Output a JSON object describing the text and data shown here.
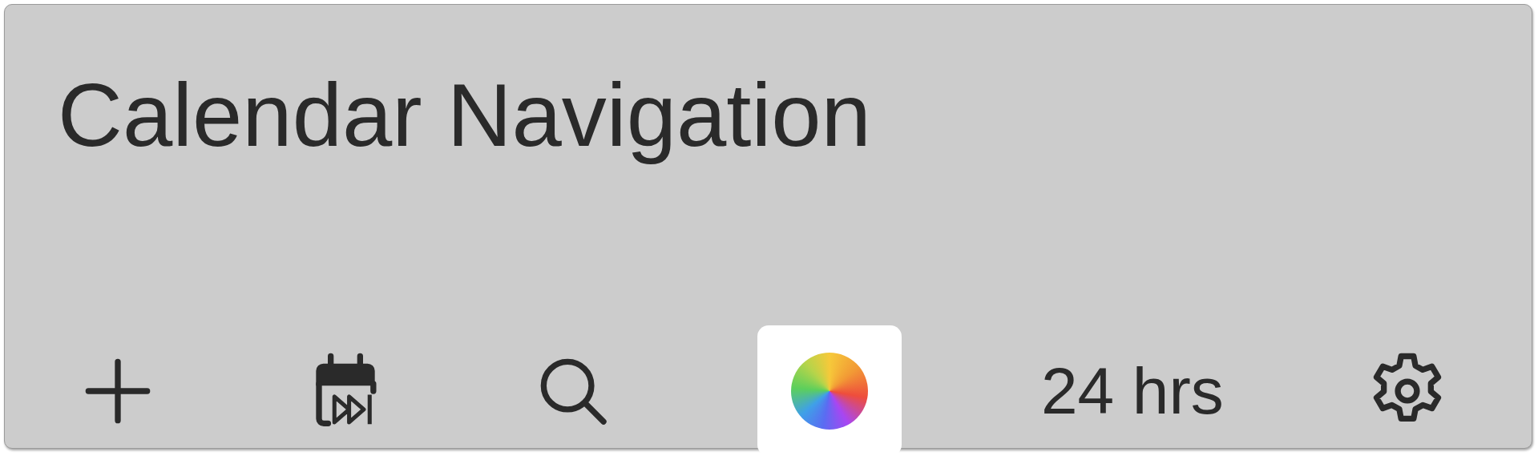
{
  "title": "Calendar Navigation",
  "toolbar": [
    {
      "kind": "add"
    },
    {
      "kind": "jump"
    },
    {
      "kind": "search"
    },
    {
      "kind": "color"
    },
    {
      "kind": "label",
      "label": "24 hrs"
    },
    {
      "kind": "settings"
    }
  ]
}
